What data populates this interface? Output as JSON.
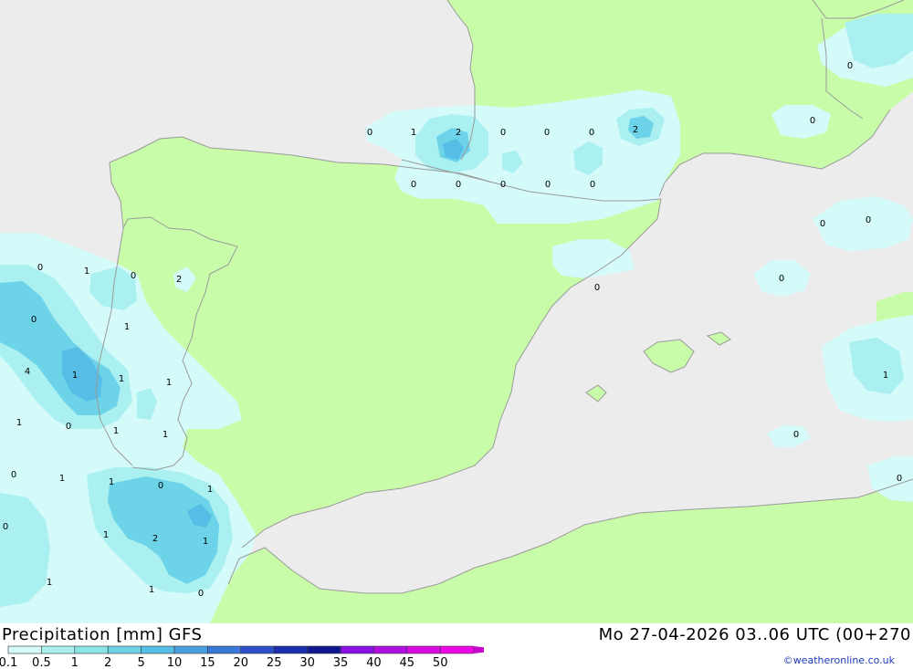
{
  "header": {
    "title": "Precipitation [mm]  GFS",
    "datetime": "Mo 27-04-2026 03..06 UTC (00+270",
    "credit": "©weatheronline.co.uk"
  },
  "legend": {
    "values": [
      "0.1",
      "0.5",
      "1",
      "2",
      "5",
      "10",
      "15",
      "20",
      "25",
      "30",
      "35",
      "40",
      "45",
      "50"
    ],
    "colors": [
      "#d4fafa",
      "#aaf0f0",
      "#8ae6e6",
      "#6dd3e8",
      "#57bde6",
      "#4a9fe0",
      "#3b79d8",
      "#2a4fc8",
      "#1b2eb0",
      "#101890",
      "#8a10e8",
      "#b00ee0",
      "#d80ae0",
      "#ee06e8",
      "#c808c8"
    ]
  },
  "map_labels": [
    "0",
    "1",
    "2",
    "0",
    "0",
    "0",
    "2",
    "0",
    "0",
    "0",
    "0",
    "0",
    "0",
    "0",
    "0",
    "0",
    "0",
    "0",
    "0",
    "1",
    "0",
    "2",
    "0",
    "1",
    "4",
    "1",
    "1",
    "1",
    "1",
    "0",
    "1",
    "1",
    "0",
    "1",
    "1",
    "0",
    "1",
    "1",
    "2",
    "1",
    "1",
    "1",
    "0",
    "0",
    "1",
    "0",
    "0"
  ],
  "colors": {
    "land": "#c8fca8",
    "sea": "#ececec",
    "border": "#9a9a9a"
  }
}
